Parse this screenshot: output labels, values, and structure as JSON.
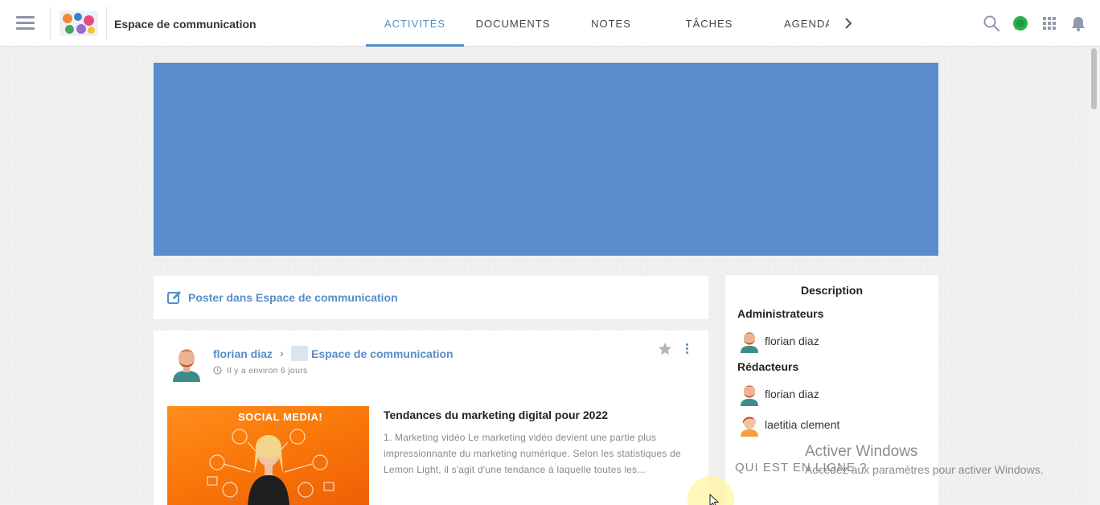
{
  "header": {
    "space_title": "Espace de communication",
    "tabs": [
      {
        "label": "ACTIVITÉS",
        "active": true
      },
      {
        "label": "DOCUMENTS",
        "active": false
      },
      {
        "label": "NOTES",
        "active": false
      },
      {
        "label": "TÂCHES",
        "active": false
      },
      {
        "label": "AGENDA",
        "active": false
      }
    ],
    "icons": [
      "menu-icon",
      "search-icon",
      "chat-icon",
      "apps-icon",
      "notifications-icon"
    ]
  },
  "composer": {
    "label": "Poster dans Espace de communication"
  },
  "post": {
    "author": "florian diaz",
    "space": "Espace de communication",
    "time": "Il y a environ 6 jours",
    "image_headline": "SOCIAL MEDIA!",
    "title": "Tendances du marketing digital pour 2022",
    "excerpt": "1. Marketing vidéo Le marketing vidéo devient une partie plus impressionnante du marketing numérique. Selon les statistiques de Lemon Light, il s'agit d'une tendance à laquelle toutes les..."
  },
  "sidebar": {
    "title": "Description",
    "admins_label": "Administrateurs",
    "admins": [
      "florian diaz"
    ],
    "editors_label": "Rédacteurs",
    "editors": [
      "florian diaz",
      "laetitia clement"
    ],
    "online_label": "QUI EST EN LIGNE ?"
  },
  "watermark": {
    "line1": "Activer Windows",
    "line2": "Accédez aux paramètres pour activer Windows."
  },
  "colors": {
    "accent": "#578dc9",
    "banner": "#5b8ccd",
    "chat_online": "#2bb24c"
  }
}
